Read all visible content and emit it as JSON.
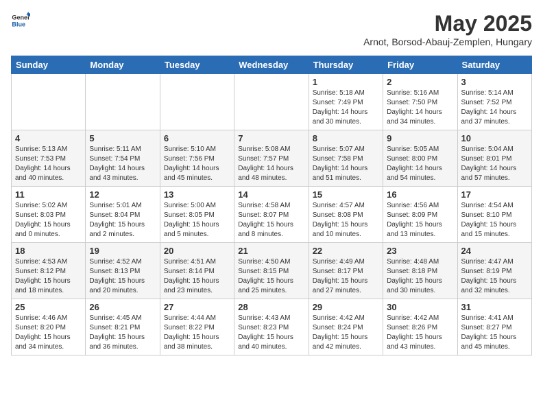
{
  "header": {
    "logo_general": "General",
    "logo_blue": "Blue",
    "title": "May 2025",
    "subtitle": "Arnot, Borsod-Abauj-Zemplen, Hungary"
  },
  "weekdays": [
    "Sunday",
    "Monday",
    "Tuesday",
    "Wednesday",
    "Thursday",
    "Friday",
    "Saturday"
  ],
  "weeks": [
    [
      {
        "day": "",
        "info": ""
      },
      {
        "day": "",
        "info": ""
      },
      {
        "day": "",
        "info": ""
      },
      {
        "day": "",
        "info": ""
      },
      {
        "day": "1",
        "info": "Sunrise: 5:18 AM\nSunset: 7:49 PM\nDaylight: 14 hours\nand 30 minutes."
      },
      {
        "day": "2",
        "info": "Sunrise: 5:16 AM\nSunset: 7:50 PM\nDaylight: 14 hours\nand 34 minutes."
      },
      {
        "day": "3",
        "info": "Sunrise: 5:14 AM\nSunset: 7:52 PM\nDaylight: 14 hours\nand 37 minutes."
      }
    ],
    [
      {
        "day": "4",
        "info": "Sunrise: 5:13 AM\nSunset: 7:53 PM\nDaylight: 14 hours\nand 40 minutes."
      },
      {
        "day": "5",
        "info": "Sunrise: 5:11 AM\nSunset: 7:54 PM\nDaylight: 14 hours\nand 43 minutes."
      },
      {
        "day": "6",
        "info": "Sunrise: 5:10 AM\nSunset: 7:56 PM\nDaylight: 14 hours\nand 45 minutes."
      },
      {
        "day": "7",
        "info": "Sunrise: 5:08 AM\nSunset: 7:57 PM\nDaylight: 14 hours\nand 48 minutes."
      },
      {
        "day": "8",
        "info": "Sunrise: 5:07 AM\nSunset: 7:58 PM\nDaylight: 14 hours\nand 51 minutes."
      },
      {
        "day": "9",
        "info": "Sunrise: 5:05 AM\nSunset: 8:00 PM\nDaylight: 14 hours\nand 54 minutes."
      },
      {
        "day": "10",
        "info": "Sunrise: 5:04 AM\nSunset: 8:01 PM\nDaylight: 14 hours\nand 57 minutes."
      }
    ],
    [
      {
        "day": "11",
        "info": "Sunrise: 5:02 AM\nSunset: 8:03 PM\nDaylight: 15 hours\nand 0 minutes."
      },
      {
        "day": "12",
        "info": "Sunrise: 5:01 AM\nSunset: 8:04 PM\nDaylight: 15 hours\nand 2 minutes."
      },
      {
        "day": "13",
        "info": "Sunrise: 5:00 AM\nSunset: 8:05 PM\nDaylight: 15 hours\nand 5 minutes."
      },
      {
        "day": "14",
        "info": "Sunrise: 4:58 AM\nSunset: 8:07 PM\nDaylight: 15 hours\nand 8 minutes."
      },
      {
        "day": "15",
        "info": "Sunrise: 4:57 AM\nSunset: 8:08 PM\nDaylight: 15 hours\nand 10 minutes."
      },
      {
        "day": "16",
        "info": "Sunrise: 4:56 AM\nSunset: 8:09 PM\nDaylight: 15 hours\nand 13 minutes."
      },
      {
        "day": "17",
        "info": "Sunrise: 4:54 AM\nSunset: 8:10 PM\nDaylight: 15 hours\nand 15 minutes."
      }
    ],
    [
      {
        "day": "18",
        "info": "Sunrise: 4:53 AM\nSunset: 8:12 PM\nDaylight: 15 hours\nand 18 minutes."
      },
      {
        "day": "19",
        "info": "Sunrise: 4:52 AM\nSunset: 8:13 PM\nDaylight: 15 hours\nand 20 minutes."
      },
      {
        "day": "20",
        "info": "Sunrise: 4:51 AM\nSunset: 8:14 PM\nDaylight: 15 hours\nand 23 minutes."
      },
      {
        "day": "21",
        "info": "Sunrise: 4:50 AM\nSunset: 8:15 PM\nDaylight: 15 hours\nand 25 minutes."
      },
      {
        "day": "22",
        "info": "Sunrise: 4:49 AM\nSunset: 8:17 PM\nDaylight: 15 hours\nand 27 minutes."
      },
      {
        "day": "23",
        "info": "Sunrise: 4:48 AM\nSunset: 8:18 PM\nDaylight: 15 hours\nand 30 minutes."
      },
      {
        "day": "24",
        "info": "Sunrise: 4:47 AM\nSunset: 8:19 PM\nDaylight: 15 hours\nand 32 minutes."
      }
    ],
    [
      {
        "day": "25",
        "info": "Sunrise: 4:46 AM\nSunset: 8:20 PM\nDaylight: 15 hours\nand 34 minutes."
      },
      {
        "day": "26",
        "info": "Sunrise: 4:45 AM\nSunset: 8:21 PM\nDaylight: 15 hours\nand 36 minutes."
      },
      {
        "day": "27",
        "info": "Sunrise: 4:44 AM\nSunset: 8:22 PM\nDaylight: 15 hours\nand 38 minutes."
      },
      {
        "day": "28",
        "info": "Sunrise: 4:43 AM\nSunset: 8:23 PM\nDaylight: 15 hours\nand 40 minutes."
      },
      {
        "day": "29",
        "info": "Sunrise: 4:42 AM\nSunset: 8:24 PM\nDaylight: 15 hours\nand 42 minutes."
      },
      {
        "day": "30",
        "info": "Sunrise: 4:42 AM\nSunset: 8:26 PM\nDaylight: 15 hours\nand 43 minutes."
      },
      {
        "day": "31",
        "info": "Sunrise: 4:41 AM\nSunset: 8:27 PM\nDaylight: 15 hours\nand 45 minutes."
      }
    ]
  ]
}
